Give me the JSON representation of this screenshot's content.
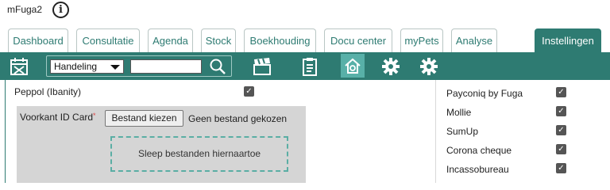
{
  "app": {
    "title": "mFuga2",
    "info_icon": "info-icon"
  },
  "tabs": [
    {
      "label": "Dashboard"
    },
    {
      "label": "Consultatie"
    },
    {
      "label": "Agenda"
    },
    {
      "label": "Stock"
    },
    {
      "label": "Boekhouding"
    },
    {
      "label": "Docu center"
    },
    {
      "label": "myPets"
    },
    {
      "label": "Analyse"
    },
    {
      "label": "Instellingen",
      "active": true
    }
  ],
  "toolbar": {
    "search_select_value": "Handeling",
    "search_input_value": "",
    "icons": [
      "calendar-x-icon",
      "search-icon",
      "clapperboard-icon",
      "clipboard-icon",
      "home-settings-icon",
      "gear-icon",
      "gear-icon"
    ]
  },
  "settings": {
    "peppol": {
      "label": "Peppol (Ibanity)",
      "checked": true
    },
    "upload": {
      "label": "Voorkant ID Card",
      "required_mark": "*",
      "button_label": "Bestand kiezen",
      "status": "Geen bestand gekozen",
      "dropzone_text": "Sleep bestanden hiernaartoe"
    },
    "options": [
      {
        "label": "Payconiq by Fuga",
        "checked": true
      },
      {
        "label": "Mollie",
        "checked": true
      },
      {
        "label": "SumUp",
        "checked": true
      },
      {
        "label": "Corona cheque",
        "checked": true
      },
      {
        "label": "Incassobureau",
        "checked": true
      }
    ]
  },
  "colors": {
    "accent": "#2e7b72",
    "accent_light": "#58b0a8",
    "upload_bg": "#d5d5d5"
  }
}
